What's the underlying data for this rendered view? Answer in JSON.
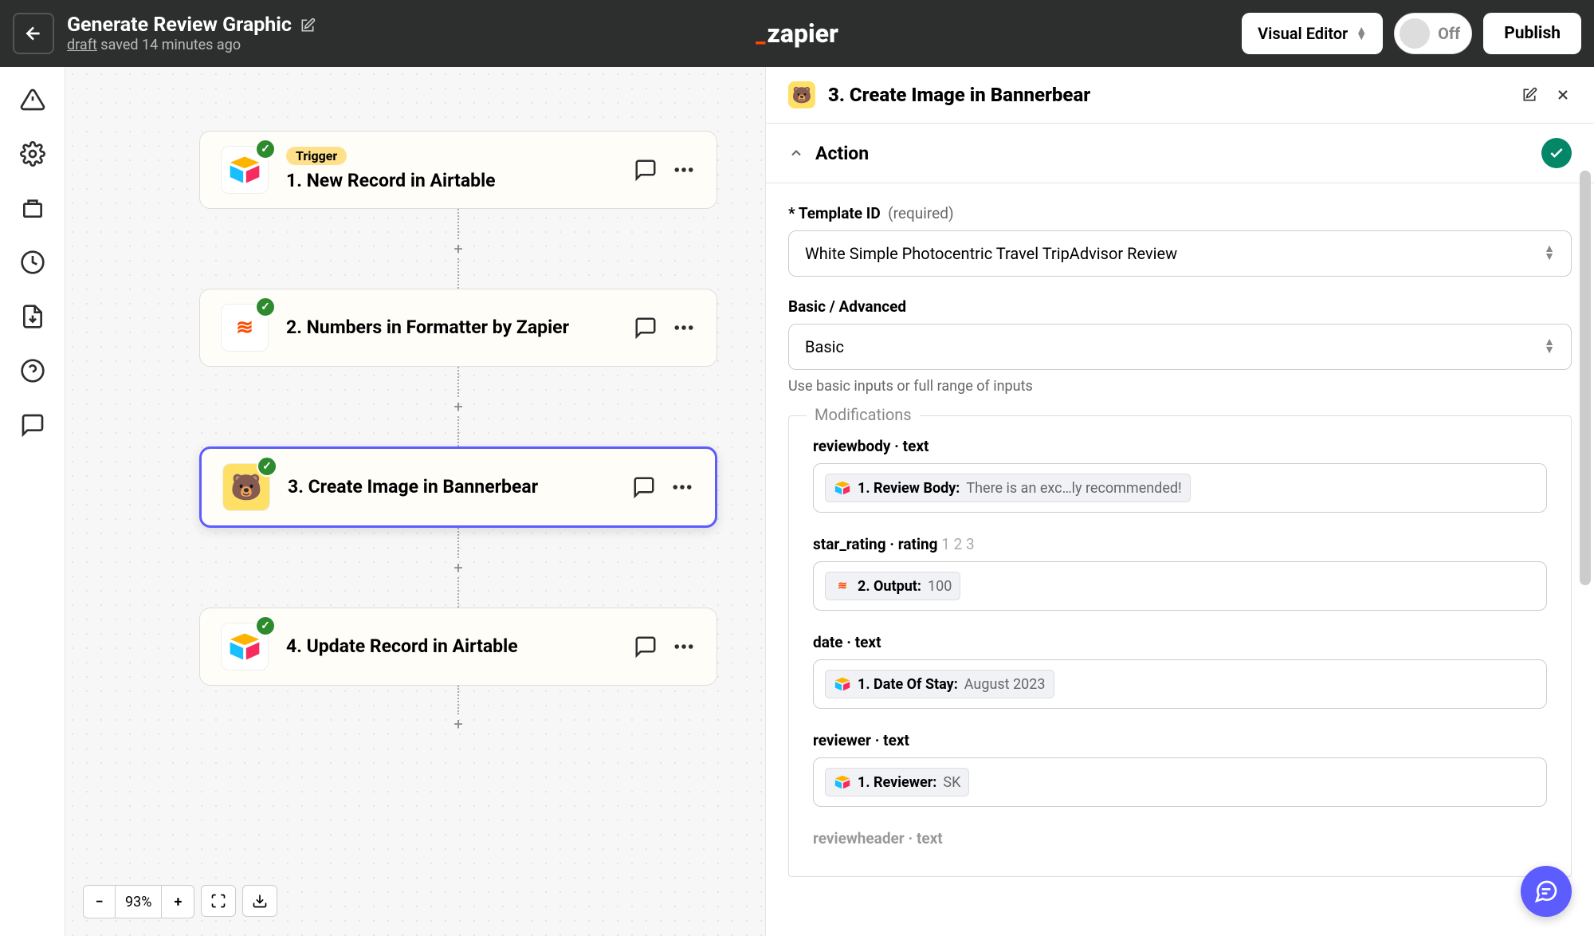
{
  "header": {
    "title": "Generate Review Graphic",
    "draft_label": "draft",
    "saved_text": " saved 14 minutes ago",
    "brand": "zapier",
    "visual_editor": "Visual Editor",
    "toggle_off": "Off",
    "publish": "Publish"
  },
  "flow": {
    "trigger_badge": "Trigger",
    "nodes": [
      {
        "title": "1. New Record in Airtable",
        "app": "airtable"
      },
      {
        "title": "2. Numbers in Formatter by Zapier",
        "app": "formatter"
      },
      {
        "title": "3. Create Image in Bannerbear",
        "app": "bannerbear"
      },
      {
        "title": "4. Update Record in Airtable",
        "app": "airtable"
      }
    ]
  },
  "zoom": {
    "value": "93%"
  },
  "panel": {
    "title": "3. Create Image in Bannerbear",
    "action_label": "Action",
    "template_label": "Template ID",
    "template_req": "(required)",
    "template_value": "White Simple Photocentric Travel TripAdvisor Review",
    "mode_label": "Basic / Advanced",
    "mode_value": "Basic",
    "mode_help": "Use basic inputs or full range of inputs",
    "modifications_label": "Modifications",
    "mods": [
      {
        "label": "reviewbody · text",
        "pill_label": "1. Review Body:",
        "pill_value": "There is an exc…ly recommended!",
        "icon": "airtable"
      },
      {
        "label": "star_rating · rating",
        "hint": "1 2 3",
        "pill_label": "2. Output:",
        "pill_value": "100",
        "icon": "formatter"
      },
      {
        "label": "date · text",
        "pill_label": "1. Date Of Stay:",
        "pill_value": "August 2023",
        "icon": "airtable"
      },
      {
        "label": "reviewer · text",
        "pill_label": "1. Reviewer:",
        "pill_value": "SK",
        "icon": "airtable"
      },
      {
        "label": "reviewheader · text"
      }
    ]
  }
}
